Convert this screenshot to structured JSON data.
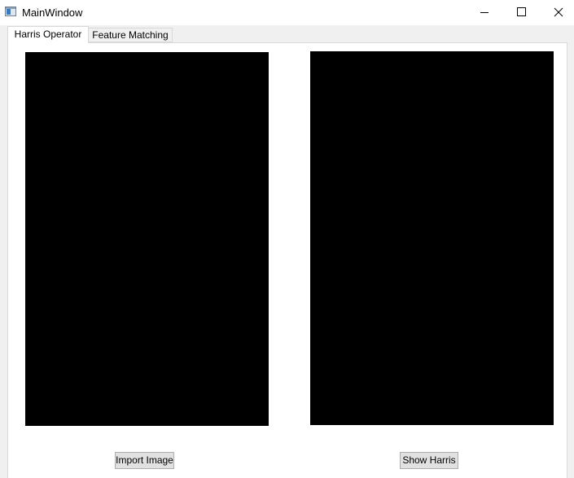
{
  "window": {
    "title": "MainWindow"
  },
  "tabs": [
    {
      "label": "Harris Operator",
      "active": true
    },
    {
      "label": "Feature Matching",
      "active": false
    }
  ],
  "harris_tab": {
    "import_button_label": "Import Image",
    "show_harris_button_label": "Show Harris"
  },
  "icons": {
    "app": "app-window-icon",
    "minimize": "minimize-icon",
    "maximize": "maximize-icon",
    "close": "close-icon"
  },
  "colors": {
    "image_panel_background": "#000000",
    "window_background": "#f0f0f0",
    "tab_page_background": "#ffffff"
  }
}
